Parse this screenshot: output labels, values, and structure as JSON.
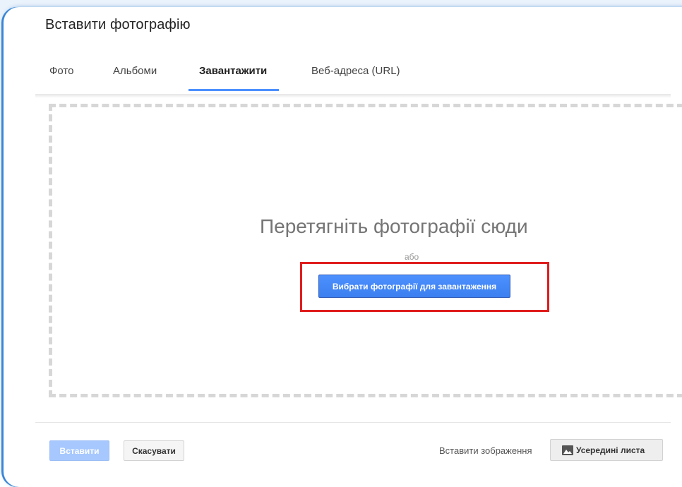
{
  "dialog": {
    "title": "Вставити фотографію"
  },
  "tabs": [
    {
      "label": "Фото",
      "active": false
    },
    {
      "label": "Альбоми",
      "active": false
    },
    {
      "label": "Завантажити",
      "active": true
    },
    {
      "label": "Веб-адреса (URL)",
      "active": false
    }
  ],
  "upload": {
    "drop_text": "Перетягніть фотографії сюди",
    "or_text": "або",
    "choose_button": "Вибрати фотографії для завантаження",
    "highlight_color": "#e01d1d"
  },
  "footer": {
    "insert_button": "Вставити",
    "cancel_button": "Скасувати",
    "insert_image_label": "Вставити зображення",
    "position_button": "Усередині листа",
    "position_icon": "image-icon"
  },
  "colors": {
    "accent": "#4d90fe",
    "accent_disabled": "#a6c8ff",
    "dialog_frame": "#3a86d6"
  }
}
